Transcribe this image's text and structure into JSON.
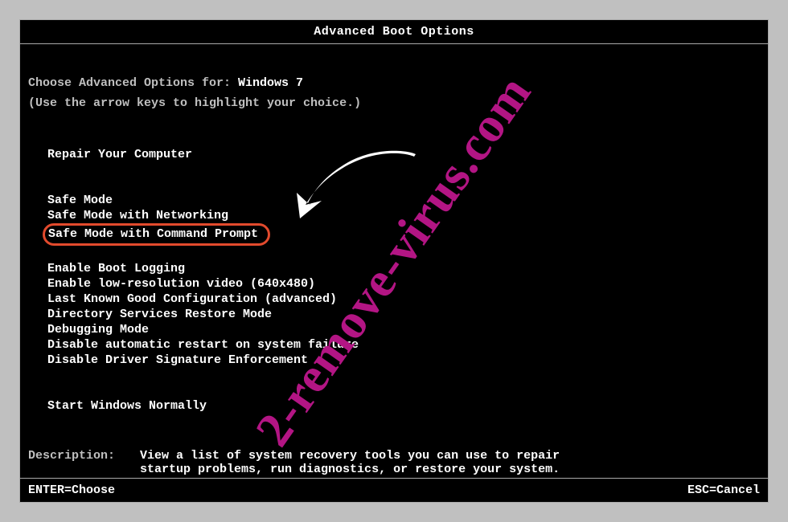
{
  "title": "Advanced Boot Options",
  "intro": {
    "label": "Choose Advanced Options for: ",
    "value": "Windows 7"
  },
  "hint": "(Use the arrow keys to highlight your choice.)",
  "options": {
    "repair": "Repair Your Computer",
    "safe": "Safe Mode",
    "safenet": "Safe Mode with Networking",
    "safecmd": "Safe Mode with Command Prompt",
    "bootlog": "Enable Boot Logging",
    "lowres": "Enable low-resolution video (640x480)",
    "lkgc": "Last Known Good Configuration (advanced)",
    "dsrm": "Directory Services Restore Mode",
    "debug": "Debugging Mode",
    "noar": "Disable automatic restart on system failure",
    "nodse": "Disable Driver Signature Enforcement",
    "normal": "Start Windows Normally"
  },
  "description": {
    "label": "Description:",
    "text": "View a list of system recovery tools you can use to repair startup problems, run diagnostics, or restore your system."
  },
  "footer": {
    "left": "ENTER=Choose",
    "right": "ESC=Cancel"
  },
  "watermark": "2-remove-virus.com"
}
